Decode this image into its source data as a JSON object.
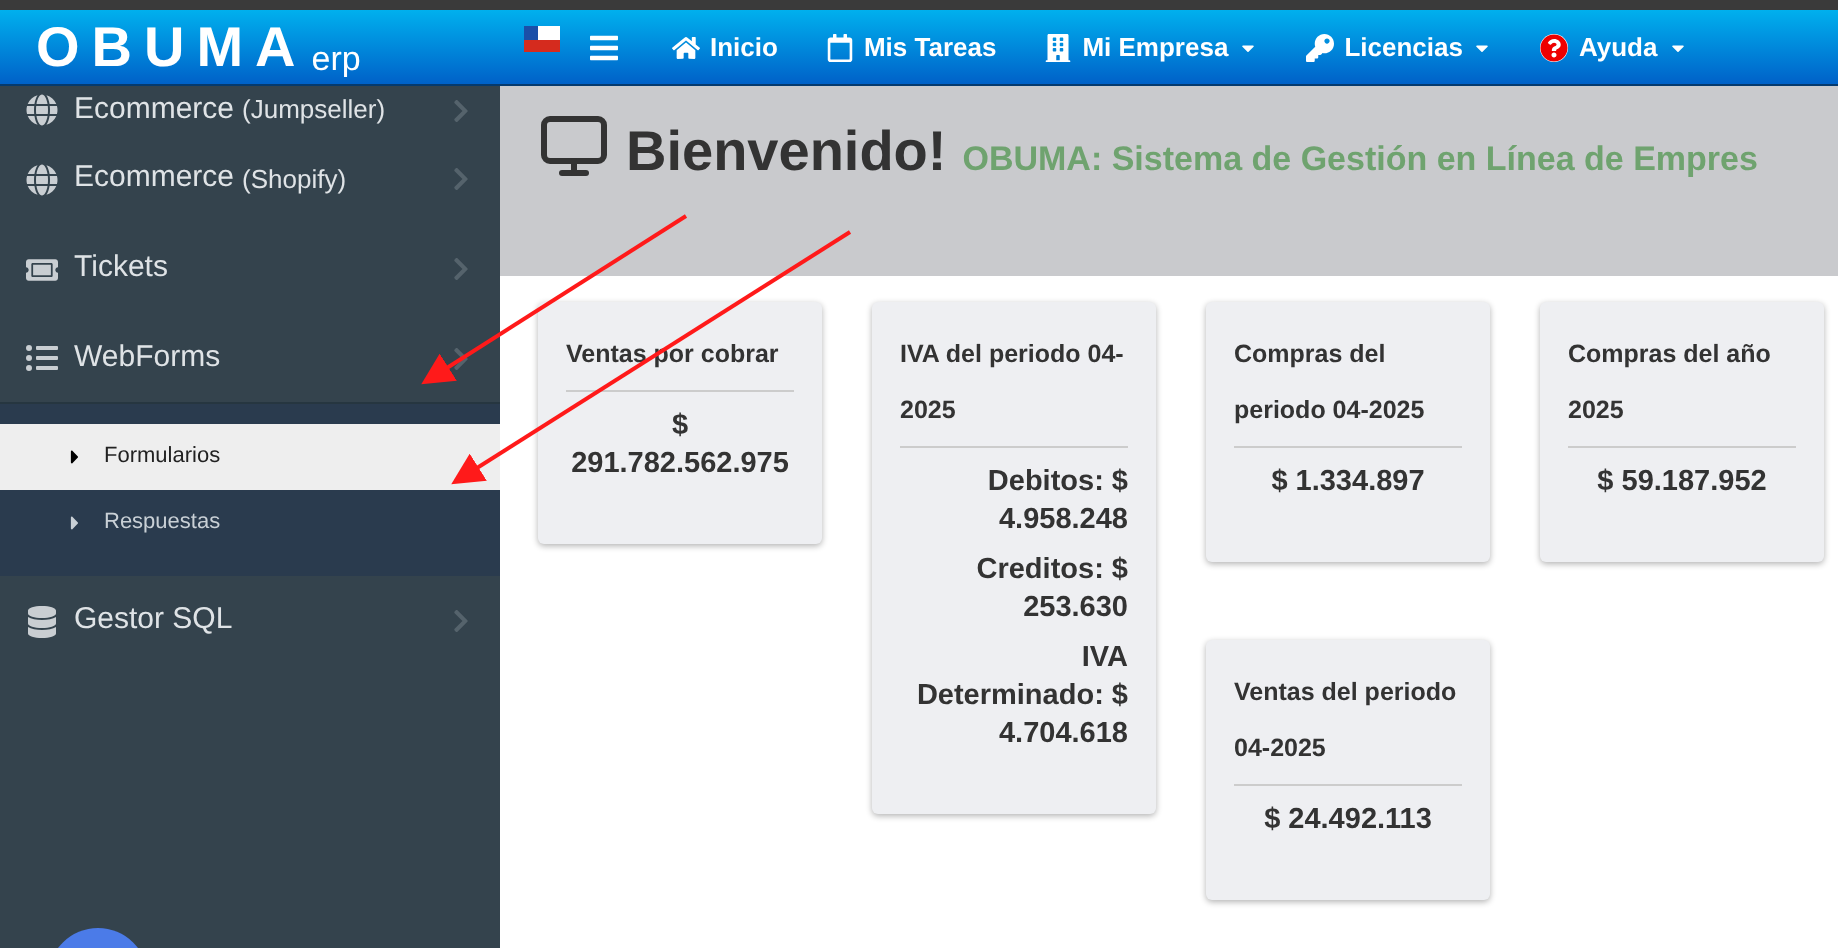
{
  "logo": {
    "name": "OBUMA",
    "suffix": "erp"
  },
  "nav": [
    {
      "label": "Inicio",
      "dropdown": false
    },
    {
      "label": "Mis Tareas",
      "dropdown": false
    },
    {
      "label": "Mi Empresa",
      "dropdown": true
    },
    {
      "label": "Licencias",
      "dropdown": true
    },
    {
      "label": "Ayuda",
      "dropdown": true
    }
  ],
  "sidebar": {
    "items": [
      {
        "label": "Ecommerce",
        "suffix": "(Jumpseller)",
        "expanded": false
      },
      {
        "label": "Ecommerce",
        "suffix": "(Shopify)",
        "expanded": false
      },
      {
        "label": "Tickets",
        "expanded": false
      },
      {
        "label": "WebForms",
        "expanded": true,
        "children": [
          {
            "label": "Formularios",
            "selected": true
          },
          {
            "label": "Respuestas",
            "selected": false
          }
        ]
      },
      {
        "label": "Gestor SQL",
        "expanded": false
      }
    ]
  },
  "header": {
    "title": "Bienvenido!",
    "subtitle": "OBUMA: Sistema de Gestión en Línea de Empres"
  },
  "card_columns": [
    [
      {
        "kind": "total",
        "title": "Ventas por cobrar",
        "lines": [
          "$ 291.782.562.975"
        ]
      }
    ],
    [
      {
        "kind": "breakdown",
        "title": "IVA del periodo 04-2025",
        "lines": [
          "Debitos: $ 4.958.248",
          "Creditos: $ 253.630",
          "IVA Determinado: $ 4.704.618"
        ]
      }
    ],
    [
      {
        "kind": "total",
        "title": "Compras del periodo 04-2025",
        "lines": [
          "$ 1.334.897"
        ]
      },
      {
        "kind": "total",
        "title": "Ventas del periodo 04-2025",
        "lines": [
          "$ 24.492.113"
        ]
      }
    ],
    [
      {
        "kind": "total",
        "title": "Compras del año 2025",
        "lines": [
          "$ 59.187.952"
        ]
      }
    ]
  ]
}
